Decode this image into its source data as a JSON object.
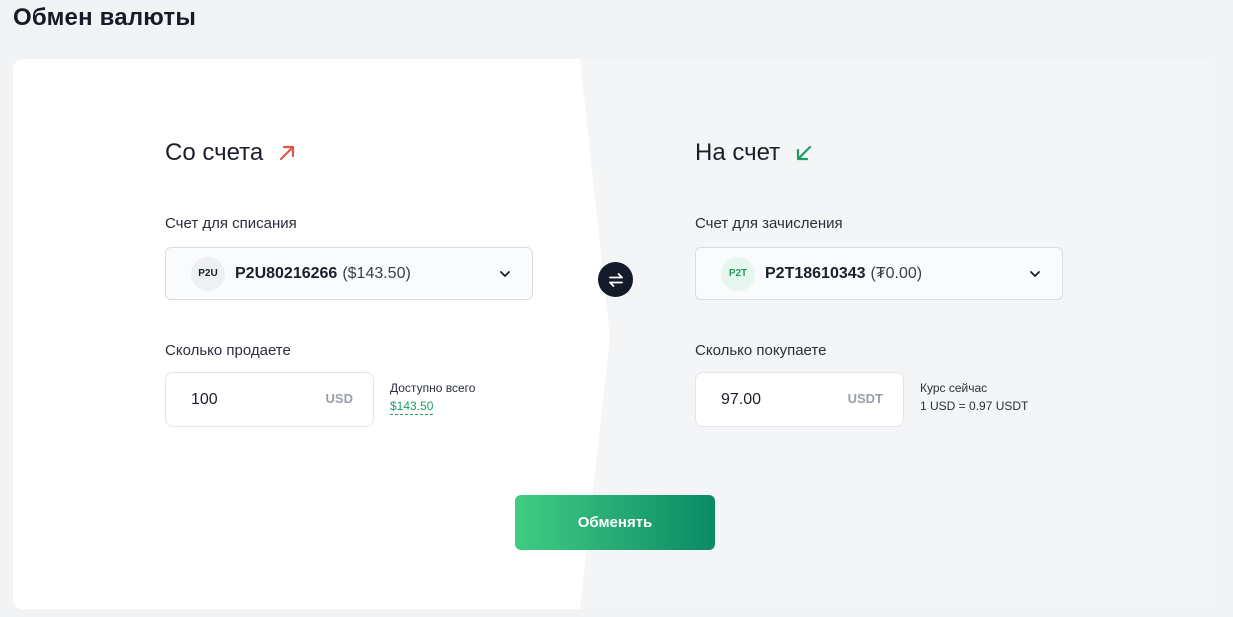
{
  "page": {
    "title": "Обмен валюты"
  },
  "from": {
    "title": "Со счета",
    "arrow_icon": "arrow-up-right-icon",
    "account_label": "Счет для списания",
    "account": {
      "badge": "P2U",
      "number": "P2U80216266",
      "balance": "($143.50)"
    },
    "amount_label": "Сколько продаете",
    "amount_value": "100",
    "currency": "USD",
    "available_label": "Доступно всего",
    "available_value": "$143.50"
  },
  "to": {
    "title": "На счет",
    "arrow_icon": "arrow-down-left-icon",
    "account_label": "Счет для зачисления",
    "account": {
      "badge": "P2T",
      "number": "P2T18610343",
      "balance": "(₮0.00)"
    },
    "amount_label": "Сколько покупаете",
    "amount_value": "97.00",
    "currency": "USDT",
    "rate_label": "Курс сейчас",
    "rate_value": "1 USD = 0.97 USDT"
  },
  "actions": {
    "submit_label": "Обменять",
    "swap_icon": "swap-arrows-icon"
  },
  "colors": {
    "accent_green": "#1f9c63",
    "arrow_out": "#e0574a",
    "arrow_in": "#1f9c63",
    "button_gradient_start": "#41cc83",
    "button_gradient_end": "#0b8a66",
    "swap_bg": "#141a2a"
  }
}
